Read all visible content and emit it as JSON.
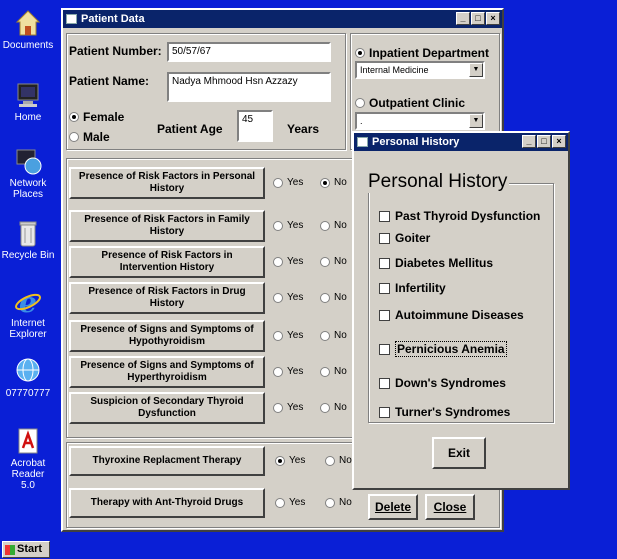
{
  "desktop": {
    "icons": [
      {
        "label": "Documents"
      },
      {
        "label": "Home"
      },
      {
        "label": "Network Places"
      },
      {
        "label": "Recycle Bin"
      },
      {
        "label": "Internet Explorer"
      },
      {
        "label": "07770777"
      },
      {
        "label": "Acrobat Reader 5.0"
      }
    ]
  },
  "taskbar": {
    "start_label": "Start"
  },
  "patient_window": {
    "title": "Patient Data",
    "patient_number_label": "Patient Number:",
    "patient_number_value": "50/57/67",
    "patient_name_label": "Patient Name:",
    "patient_name_value": "Nadya Mhmood Hsn Azzazy",
    "female_label": "Female",
    "male_label": "Male",
    "age_label": "Patient Age",
    "age_value": "45",
    "years_label": "Years",
    "inpatient_label": "Inpatient Department",
    "inpatient_value": "Internal Medicine",
    "outpatient_label": "Outpatient Clinic",
    "outpatient_value": ".",
    "yes_label": "Yes",
    "no_label": "No",
    "risk_rows": [
      {
        "label": "Presence of Risk Factors in Personal History",
        "selected": "no"
      },
      {
        "label": "Presence of Risk Factors in Family History",
        "selected": "none"
      },
      {
        "label": "Presence of Risk Factors in Intervention History",
        "selected": "none"
      },
      {
        "label": "Presence of Risk Factors in Drug History",
        "selected": "none"
      },
      {
        "label": "Presence of Signs and Symptoms of Hypothyroidism",
        "selected": "none"
      },
      {
        "label": "Presence of Signs and Symptoms of Hyperthyroidism",
        "selected": "none"
      },
      {
        "label": "Suspicion of Secondary Thyroid Dysfunction",
        "selected": "none"
      }
    ],
    "therapy_rows": [
      {
        "label": "Thyroxine Replacment Therapy",
        "selected": "yes"
      },
      {
        "label": "Therapy  with Ant-Thyroid Drugs",
        "selected": "none"
      }
    ],
    "delete_label": "Delete",
    "close_label": "Close"
  },
  "history_window": {
    "title": "Personal History",
    "heading": "Personal History",
    "items": [
      "Past  Thyroid Dysfunction",
      "Goiter",
      "Diabetes Mellitus",
      "Infertility",
      "Autoimmune Diseases",
      "Pernicious Anemia",
      "Down's Syndromes",
      "Turner's Syndromes"
    ],
    "exit_label": "Exit"
  }
}
